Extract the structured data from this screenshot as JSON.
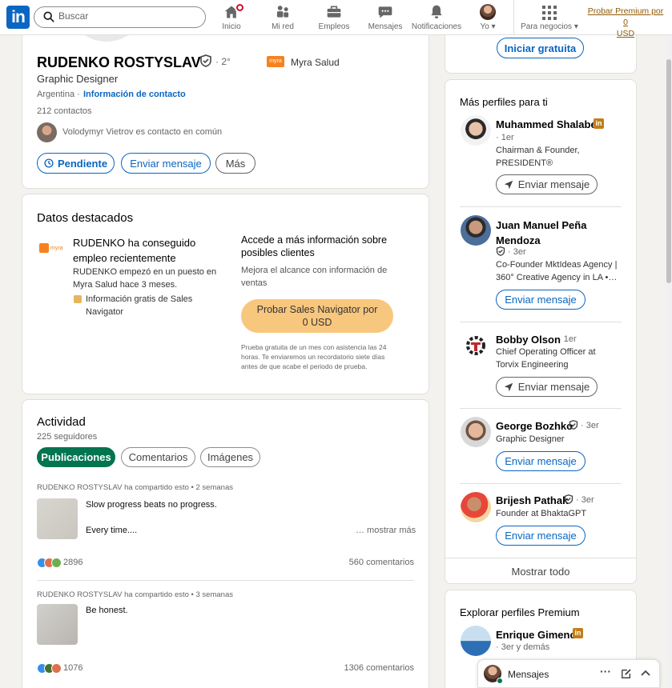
{
  "nav": {
    "search_placeholder": "Buscar",
    "items": [
      {
        "label": "Inicio"
      },
      {
        "label": "Mi red"
      },
      {
        "label": "Empleos"
      },
      {
        "label": "Mensajes"
      },
      {
        "label": "Notificaciones"
      },
      {
        "label": "Yo ▾"
      },
      {
        "label": "Para negocios ▾"
      }
    ],
    "premium_line1": "Probar Premium por 0",
    "premium_line2": "USD"
  },
  "profile": {
    "name": "RUDENKO ROSTYSLAV",
    "degree": "· 2°",
    "headline": "Graphic Designer",
    "company": "Myra Salud",
    "location": "Argentina ·",
    "contact_info": "Información de contacto",
    "connections": "212 contactos",
    "mutual": "Volodymyr Vietrov es contacto en común",
    "buttons": {
      "pending": "Pendiente",
      "message": "Enviar mensaje",
      "more": "Más"
    }
  },
  "highlights": {
    "title": "Datos destacados",
    "job_title": "RUDENKO ha conseguido empleo recientemente",
    "job_line1": "RUDENKO empezó en un puesto en",
    "job_line2": "Myra Salud hace 3 meses.",
    "sales_nav_line1": "Información gratis de Sales",
    "sales_nav_line2": "Navigator",
    "access_title": "Accede a más información sobre posibles clientes",
    "access_desc": "Mejora el alcance con información de ventas",
    "cta_line1": "Probar Sales Navigator por",
    "cta_line2": "0 USD",
    "fine_print": "Prueba gratuita de un mes con asistencia las 24 horas. Te enviaremos un recordatorio siete días antes de que acabe el periodo de prueba."
  },
  "activity": {
    "title": "Actividad",
    "followers": "225 seguidores",
    "tabs": [
      {
        "label": "Publicaciones"
      },
      {
        "label": "Comentarios"
      },
      {
        "label": "Imágenes"
      }
    ],
    "posts": [
      {
        "meta_name": "RUDENKO ROSTYSLAV",
        "meta_rest": "ha compartido esto • 2 semanas",
        "text1": "Slow progress beats no progress.",
        "text2": "Every time....",
        "more": "… mostrar más",
        "reactions": "2896",
        "comments": "560 comentarios"
      },
      {
        "meta_name": "RUDENKO ROSTYSLAV",
        "meta_rest": "ha compartido esto • 3 semanas",
        "text1": "Be honest.",
        "reactions": "1076",
        "comments": "1306 comentarios"
      }
    ]
  },
  "right": {
    "start_free": "Iniciar gratuita",
    "more_profiles_title": "Más perfiles para ti",
    "people": [
      {
        "name": "Muhammed Shalabe",
        "degree": "· 1er",
        "headline1": "Chairman & Founder,",
        "headline2": "PRESIDENT®",
        "button": "Enviar mensaje"
      },
      {
        "name1": "Juan Manuel Peña",
        "name2": "Mendoza",
        "degree": "· 3er",
        "headline1": "Co-Founder MktIdeas Agency |",
        "headline2": "360° Creative Agency in LA •…",
        "button": "Enviar mensaje"
      },
      {
        "name": "Bobby Olson",
        "degree": "· 1er",
        "headline1": "Chief Operating Officer at",
        "headline2": "Torvix Engineering",
        "button": "Enviar mensaje"
      },
      {
        "name": "George Bozhko",
        "degree": "· 3er",
        "headline1": "Graphic Designer",
        "button": "Enviar mensaje"
      },
      {
        "name": "Brijesh Pathak",
        "degree": "· 3er",
        "headline1": "Founder at BhaktaGPT",
        "button": "Enviar mensaje"
      }
    ],
    "show_all": "Mostrar todo",
    "premium_title": "Explorar perfiles Premium",
    "premium_person": {
      "name": "Enrique Gimeno",
      "degree": "· 3er y demás"
    }
  },
  "messaging": {
    "label": "Mensajes"
  }
}
